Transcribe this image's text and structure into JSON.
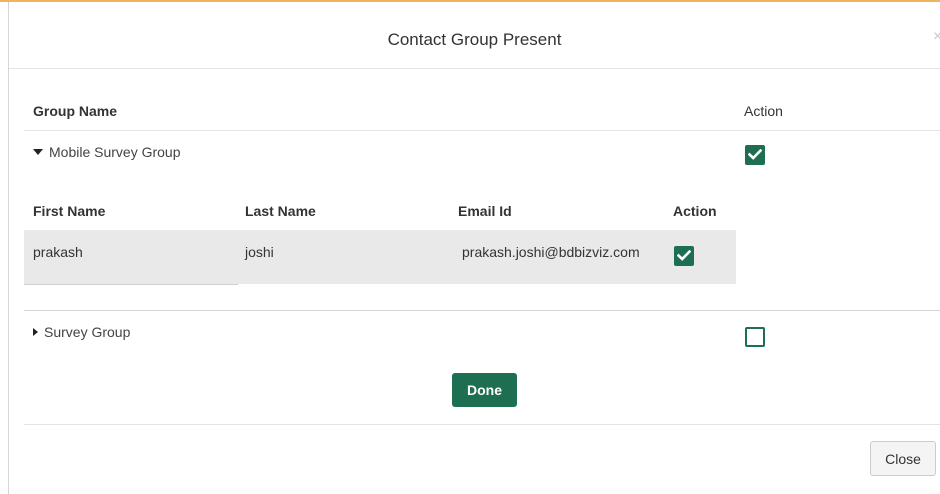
{
  "dialog": {
    "title": "Contact Group Present"
  },
  "table": {
    "columns": {
      "group_name": "Group Name",
      "action": "Action"
    },
    "groups": [
      {
        "name": "Mobile Survey Group",
        "expanded": true,
        "checked": true,
        "members": {
          "columns": {
            "first_name": "First Name",
            "last_name": "Last Name",
            "email": "Email Id",
            "action": "Action"
          },
          "rows": [
            {
              "first_name": "prakash",
              "last_name": "joshi",
              "email": "prakash.joshi@bdbizviz.com",
              "checked": true
            }
          ]
        }
      },
      {
        "name": "Survey Group",
        "expanded": false,
        "checked": false
      }
    ]
  },
  "buttons": {
    "done": "Done",
    "close": "Close"
  },
  "icons": {
    "close": "close-x-icon",
    "expanded": "caret-down-icon",
    "collapsed": "caret-right-icon",
    "checkbox": "checkbox-icon"
  },
  "colors": {
    "accent": "#1e6e52",
    "top_border": "#f0b45a",
    "row_highlight": "#e9e9e9"
  }
}
